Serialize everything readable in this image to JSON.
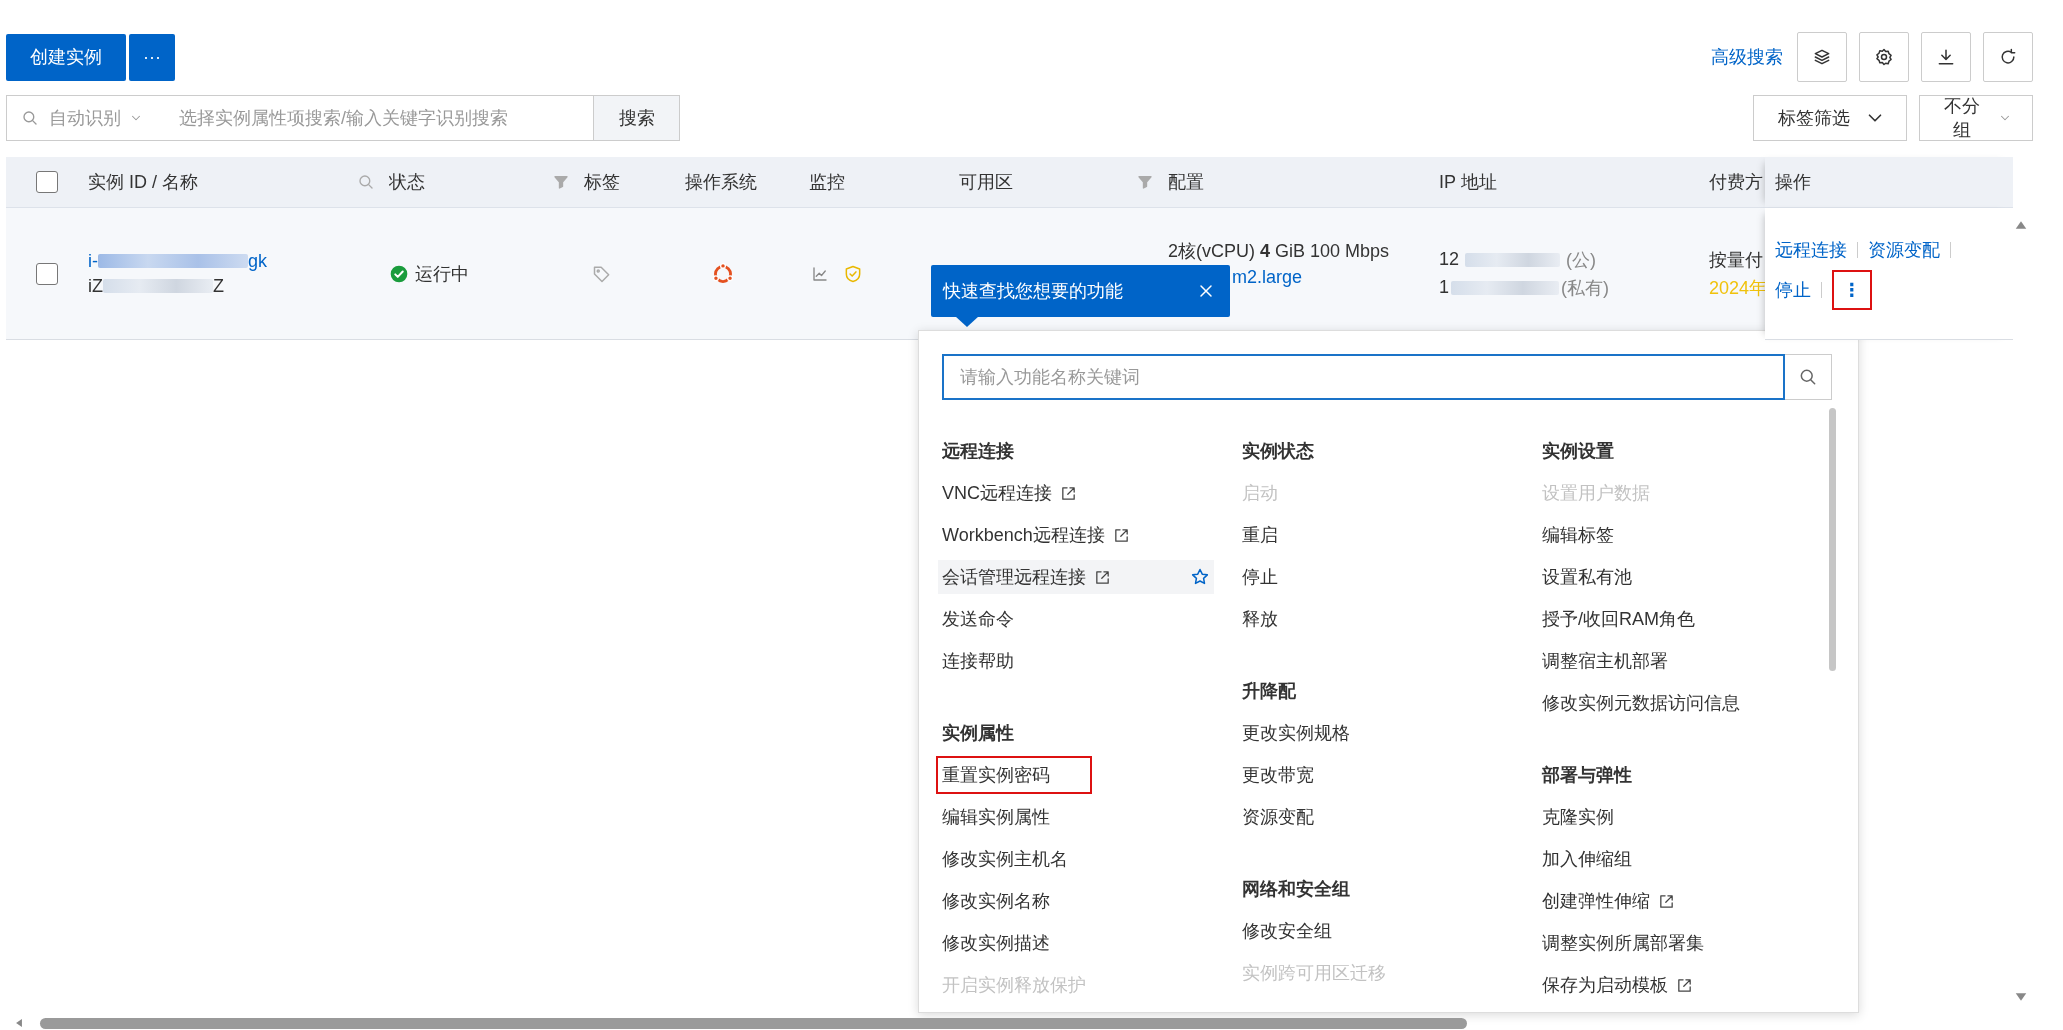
{
  "toolbar": {
    "create_button": "创建实例",
    "more_button": "···",
    "advanced_search": "高级搜索"
  },
  "search": {
    "scope": "自动识别",
    "placeholder": "选择实例属性项搜索/输入关键字识别搜索",
    "button": "搜索"
  },
  "tag_filter": "标签筛选",
  "grouping": "不分组",
  "table": {
    "header_checked": false,
    "columns": [
      {
        "label": "实例 ID / 名称",
        "kind": "search"
      },
      {
        "label": "状态",
        "kind": "filter"
      },
      {
        "label": "标签",
        "kind": "plain"
      },
      {
        "label": "操作系统",
        "kind": "plain"
      },
      {
        "label": "监控",
        "kind": "plain"
      },
      {
        "label": "可用区",
        "kind": "filter"
      },
      {
        "label": "配置",
        "kind": "plain"
      },
      {
        "label": "IP 地址",
        "kind": "plain"
      },
      {
        "label": "付费方",
        "kind": "plain"
      },
      {
        "label": "操作",
        "kind": "plain"
      }
    ],
    "rows": [
      {
        "checked": false,
        "id_start": "i-",
        "id_end": "gk",
        "name_start": "iZ",
        "name_end": "Z",
        "status": "运行中",
        "config_line_1": "2核(vCPU) **4** GiB 100 Mbps",
        "config_line_2": "m2.large",
        "ip_public_start": "12",
        "ip_public_suffix": "(公)",
        "ip_private_start": "1",
        "ip_private_suffix": "(私有)",
        "billing": "按量付",
        "billing_date": "2024年",
        "actions": [
          {
            "kind": "link",
            "label": "远程连接",
            "annotated": false
          },
          {
            "kind": "link",
            "label": "资源变配",
            "annotated": false
          },
          {
            "kind": "link",
            "label": "停止",
            "annotated": false
          },
          {
            "kind": "more",
            "label": "⋮",
            "annotated": true
          }
        ]
      }
    ]
  },
  "tooltip": {
    "text": "快速查找您想要的功能"
  },
  "menu": {
    "placeholder": "请输入功能名称关键词",
    "columns": [
      {
        "groups": [
          {
            "title": "远程连接",
            "items": [
              {
                "label": "VNC远程连接",
                "disabled": false,
                "external": true,
                "hovered": false,
                "annotated": false
              },
              {
                "label": "Workbench远程连接",
                "disabled": false,
                "external": true,
                "hovered": false,
                "annotated": false
              },
              {
                "label": "会话管理远程连接",
                "disabled": false,
                "external": true,
                "hovered": true,
                "annotated": false
              },
              {
                "label": "发送命令",
                "disabled": false,
                "external": false,
                "hovered": false,
                "annotated": false
              },
              {
                "label": "连接帮助",
                "disabled": false,
                "external": false,
                "hovered": false,
                "annotated": false
              }
            ]
          },
          {
            "title": "实例属性",
            "items": [
              {
                "label": "重置实例密码",
                "disabled": false,
                "external": false,
                "hovered": false,
                "annotated": true
              },
              {
                "label": "编辑实例属性",
                "disabled": false,
                "external": false,
                "hovered": false,
                "annotated": false
              },
              {
                "label": "修改实例主机名",
                "disabled": false,
                "external": false,
                "hovered": false,
                "annotated": false
              },
              {
                "label": "修改实例名称",
                "disabled": false,
                "external": false,
                "hovered": false,
                "annotated": false
              },
              {
                "label": "修改实例描述",
                "disabled": false,
                "external": false,
                "hovered": false,
                "annotated": false
              },
              {
                "label": "开启实例释放保护",
                "disabled": true,
                "external": false,
                "hovered": false,
                "annotated": false
              }
            ]
          }
        ]
      },
      {
        "groups": [
          {
            "title": "实例状态",
            "items": [
              {
                "label": "启动",
                "disabled": true,
                "external": false,
                "hovered": false,
                "annotated": false
              },
              {
                "label": "重启",
                "disabled": false,
                "external": false,
                "hovered": false,
                "annotated": false
              },
              {
                "label": "停止",
                "disabled": false,
                "external": false,
                "hovered": false,
                "annotated": false
              },
              {
                "label": "释放",
                "disabled": false,
                "external": false,
                "hovered": false,
                "annotated": false
              }
            ]
          },
          {
            "title": "升降配",
            "items": [
              {
                "label": "更改实例规格",
                "disabled": false,
                "external": false,
                "hovered": false,
                "annotated": false
              },
              {
                "label": "更改带宽",
                "disabled": false,
                "external": false,
                "hovered": false,
                "annotated": false
              },
              {
                "label": "资源变配",
                "disabled": false,
                "external": false,
                "hovered": false,
                "annotated": false
              }
            ]
          },
          {
            "title": "网络和安全组",
            "items": [
              {
                "label": "修改安全组",
                "disabled": false,
                "external": false,
                "hovered": false,
                "annotated": false
              },
              {
                "label": "实例跨可用区迁移",
                "disabled": true,
                "external": false,
                "hovered": false,
                "annotated": false
              }
            ]
          }
        ]
      },
      {
        "groups": [
          {
            "title": "实例设置",
            "items": [
              {
                "label": "设置用户数据",
                "disabled": true,
                "external": false,
                "hovered": false,
                "annotated": false
              },
              {
                "label": "编辑标签",
                "disabled": false,
                "external": false,
                "hovered": false,
                "annotated": false
              },
              {
                "label": "设置私有池",
                "disabled": false,
                "external": false,
                "hovered": false,
                "annotated": false
              },
              {
                "label": "授予/收回RAM角色",
                "disabled": false,
                "external": false,
                "hovered": false,
                "annotated": false
              },
              {
                "label": "调整宿主机部署",
                "disabled": false,
                "external": false,
                "hovered": false,
                "annotated": false
              },
              {
                "label": "修改实例元数据访问信息",
                "disabled": false,
                "external": false,
                "hovered": false,
                "annotated": false
              }
            ]
          },
          {
            "title": "部署与弹性",
            "items": [
              {
                "label": "克隆实例",
                "disabled": false,
                "external": false,
                "hovered": false,
                "annotated": false
              },
              {
                "label": "加入伸缩组",
                "disabled": false,
                "external": false,
                "hovered": false,
                "annotated": false
              },
              {
                "label": "创建弹性伸缩",
                "disabled": false,
                "external": true,
                "hovered": false,
                "annotated": false
              },
              {
                "label": "调整实例所属部署集",
                "disabled": false,
                "external": false,
                "hovered": false,
                "annotated": false
              },
              {
                "label": "保存为启动模板",
                "disabled": false,
                "external": true,
                "hovered": false,
                "annotated": false
              }
            ]
          }
        ]
      }
    ]
  }
}
